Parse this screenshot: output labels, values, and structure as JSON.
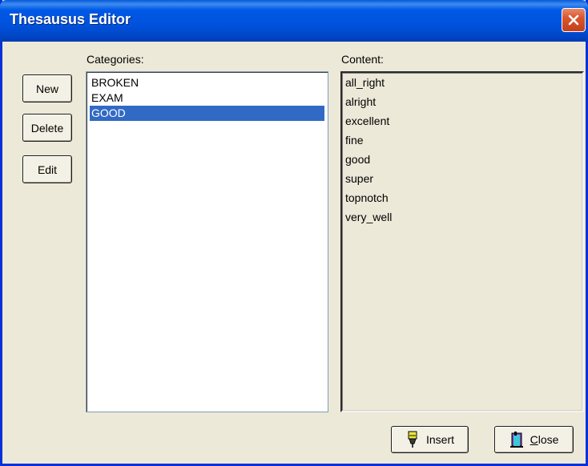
{
  "window": {
    "title": "Thesausus Editor"
  },
  "buttons": {
    "new": "New",
    "delete": "Delete",
    "edit": "Edit"
  },
  "categories": {
    "label": "Categories:",
    "items": [
      "BROKEN",
      "EXAM",
      "GOOD"
    ],
    "selected": "GOOD"
  },
  "content": {
    "label": "Content:",
    "items": [
      "all_right",
      "alright",
      "excellent",
      "fine",
      "good",
      "super",
      "topnotch",
      "very_well"
    ]
  },
  "footer": {
    "insert_label": "Insert",
    "close_label": "Close",
    "close_mnemonic": "C",
    "close_rest": "lose"
  },
  "icons": {
    "insert": "pen-insert-icon",
    "close": "door-close-icon",
    "title_close": "close-icon"
  },
  "colors": {
    "title_bar": "#0054e3",
    "selection": "#316ac5",
    "window_face": "#ece9d8"
  }
}
